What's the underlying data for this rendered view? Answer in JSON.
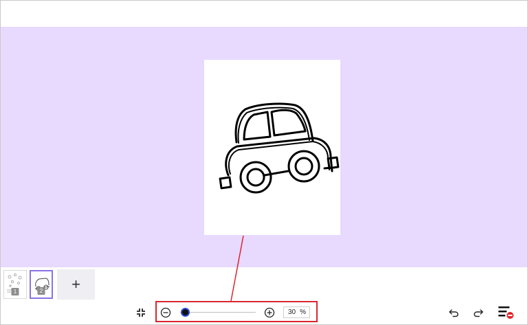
{
  "canvas": {
    "background": "#e8d9ff"
  },
  "pages": [
    {
      "number": "1",
      "selected": false
    },
    {
      "number": "2",
      "selected": true
    }
  ],
  "add_page": {
    "label": "+"
  },
  "zoom": {
    "value": "30",
    "unit": "%",
    "level": 0.3
  },
  "accent": {
    "highlight": "#d9262e",
    "selected": "#8a72e6",
    "slider": "#2a4ad6"
  },
  "icons": {
    "fit": "collapse-icon",
    "zoom_out": "zoom-out-icon",
    "zoom_in": "zoom-in-icon",
    "undo": "undo-icon",
    "redo": "redo-icon",
    "menu": "menu-remove-icon"
  }
}
